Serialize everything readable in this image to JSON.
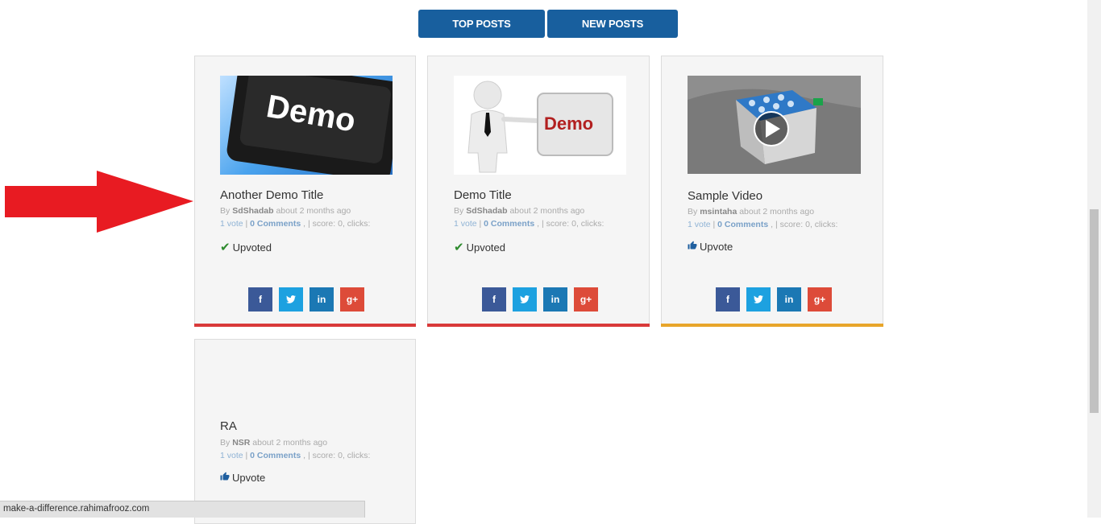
{
  "tabs": {
    "top_posts": "TOP POSTS",
    "new_posts": "NEW POSTS"
  },
  "cards": [
    {
      "title": "Another Demo Title",
      "by": "By",
      "author": "SdShadab",
      "time": "about 2 months ago",
      "votes": "1 vote",
      "comments": "0 Comments",
      "stats": ", | score: 0, clicks:",
      "vote_label": "Upvoted",
      "vote_state": "upvoted",
      "accent": "#d93a3a",
      "thumb_text": "Demo"
    },
    {
      "title": "Demo Title",
      "by": "By",
      "author": "SdShadab",
      "time": "about 2 months ago",
      "votes": "1 vote",
      "comments": "0 Comments",
      "stats": ", | score: 0, clicks:",
      "vote_label": "Upvoted",
      "vote_state": "upvoted",
      "accent": "#d93a3a",
      "thumb_text": "Demo"
    },
    {
      "title": "Sample Video",
      "by": "By",
      "author": "msintaha",
      "time": "about 2 months ago",
      "votes": "1 vote",
      "comments": "0 Comments",
      "stats": ", | score: 0, clicks:",
      "vote_label": "Upvote",
      "vote_state": "upvote",
      "accent": "#e8a52a"
    },
    {
      "title": "RA",
      "by": "By",
      "author": "NSR",
      "time": "about 2 months ago",
      "votes": "1 vote",
      "comments": "0 Comments",
      "stats": ", | score: 0, clicks:",
      "vote_label": "Upvote",
      "vote_state": "upvote"
    }
  ],
  "social": {
    "facebook": "f",
    "twitter": "t",
    "linkedin": "in",
    "googleplus": "g+"
  },
  "status_url": "make-a-difference.rahimafrooz.com",
  "colors": {
    "button_blue": "#185f9e",
    "arrow_red": "#e81b22"
  }
}
